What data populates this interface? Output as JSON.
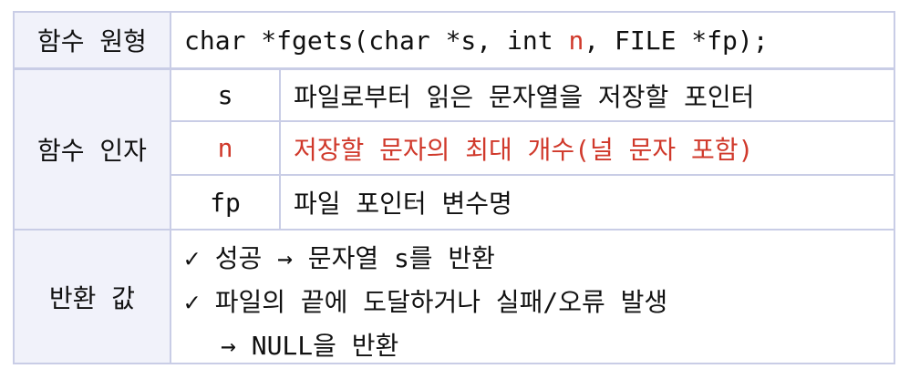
{
  "table": {
    "prototype": {
      "label": "함수 원형",
      "code_prefix": "char *fgets(char *s, int ",
      "code_highlight": "n",
      "code_suffix": ", FILE *fp);"
    },
    "arguments": {
      "label": "함수 인자",
      "rows": [
        {
          "name": "s",
          "desc": "파일로부터 읽은 문자열을 저장할 포인터"
        },
        {
          "name": "n",
          "desc": "저장할 문자의 최대 개수(널 문자 포함)"
        },
        {
          "name": "fp",
          "desc": "파일 포인터 변수명"
        }
      ]
    },
    "returns": {
      "label": "반환 값",
      "lines": [
        "✓ 성공 → 문자열 s를 반환",
        "✓ 파일의 끝에 도달하거나 실패/오류 발생",
        "→ NULL을 반환"
      ]
    }
  },
  "colors": {
    "highlight": "#d0392b",
    "border": "#c9cde6",
    "label_background": "#f1f2fa"
  }
}
